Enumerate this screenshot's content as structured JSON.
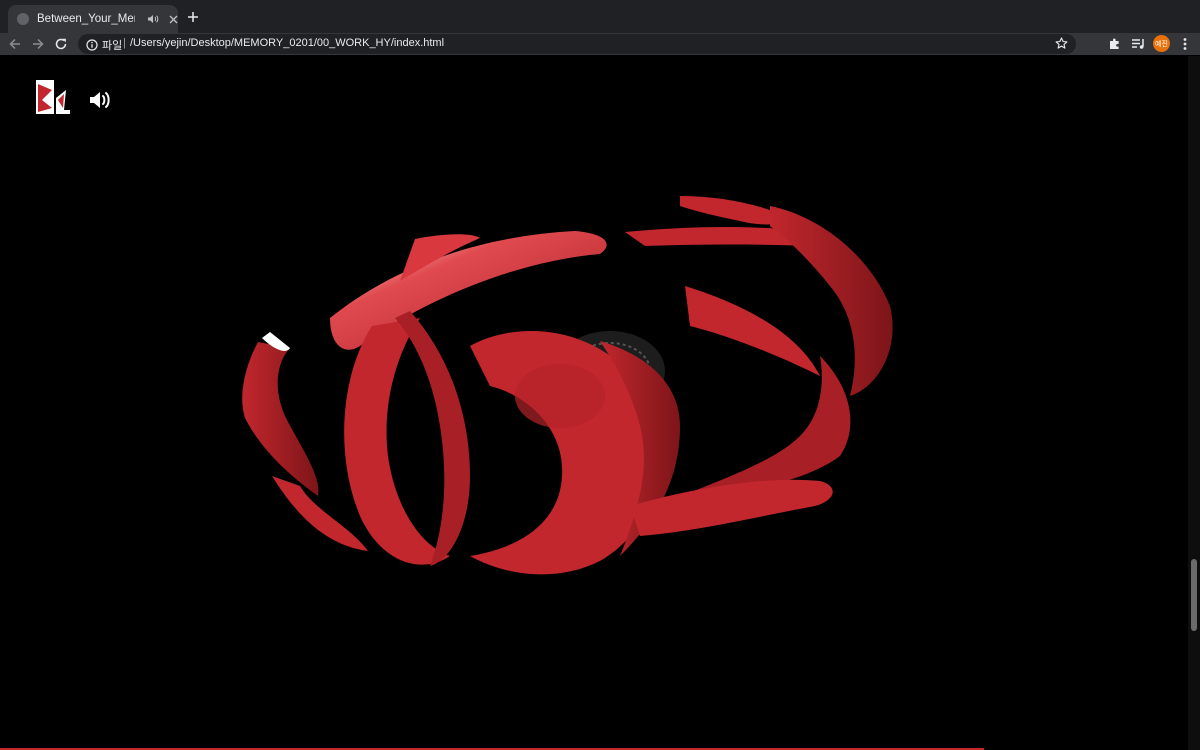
{
  "browser": {
    "tab_title": "Between_Your_Memories",
    "address_scheme": "파일",
    "address_separator": "|",
    "url": "/Users/yejin/Desktop/MEMORY_0201/00_WORK_HY/index.html",
    "profile_label": "예진"
  },
  "page": {
    "accent_color": "#c1272d",
    "sound_state": "on"
  },
  "scroll": {
    "position_fraction": 0.82
  },
  "icons": {
    "tab_favicon": "globe-icon",
    "tab_audio": "speaker-icon",
    "tab_close": "close-icon",
    "new_tab": "plus-icon",
    "back": "back-arrow-icon",
    "forward": "forward-arrow-icon",
    "reload": "reload-icon",
    "site_info": "info-icon",
    "bookmark": "star-icon",
    "extensions": "puzzle-icon",
    "media": "playlist-icon",
    "menu": "kebab-menu-icon",
    "page_sound": "volume-icon"
  }
}
